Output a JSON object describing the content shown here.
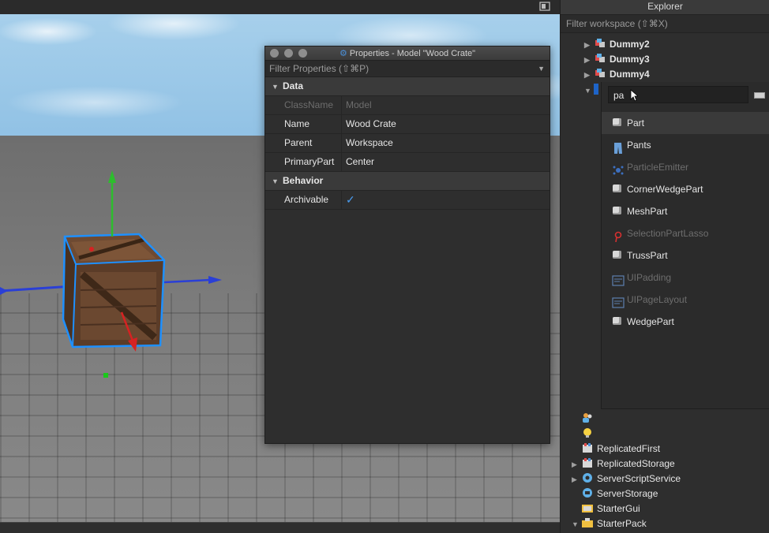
{
  "viewport": {
    "corner_icon": "screen-icon"
  },
  "properties": {
    "title": "Properties - Model \"Wood Crate\"",
    "filter_placeholder": "Filter Properties (⇧⌘P)",
    "sections": [
      {
        "name": "Data",
        "rows": [
          {
            "key": "ClassName",
            "value": "Model",
            "disabled": true
          },
          {
            "key": "Name",
            "value": "Wood Crate",
            "disabled": false
          },
          {
            "key": "Parent",
            "value": "Workspace",
            "disabled": false
          },
          {
            "key": "PrimaryPart",
            "value": "Center",
            "disabled": false
          }
        ]
      },
      {
        "name": "Behavior",
        "rows": [
          {
            "key": "Archivable",
            "value": "✓",
            "checkbox": true
          }
        ]
      }
    ]
  },
  "explorer": {
    "title": "Explorer",
    "filter_placeholder": "Filter workspace (⇧⌘X)",
    "top_items": [
      {
        "label": "Dummy2",
        "icon": "model-icon"
      },
      {
        "label": "Dummy3",
        "icon": "model-icon"
      },
      {
        "label": "Dummy4",
        "icon": "model-icon"
      }
    ],
    "bottom_items": [
      {
        "label": "ReplicatedFirst",
        "icon": "replicated-first-icon",
        "expandable": false
      },
      {
        "label": "ReplicatedStorage",
        "icon": "replicated-storage-icon",
        "expandable": true
      },
      {
        "label": "ServerScriptService",
        "icon": "server-script-service-icon",
        "expandable": true
      },
      {
        "label": "ServerStorage",
        "icon": "server-storage-icon",
        "expandable": false
      },
      {
        "label": "StarterGui",
        "icon": "starter-gui-icon",
        "expandable": false
      },
      {
        "label": "StarterPack",
        "icon": "starter-pack-icon",
        "expandable": true
      }
    ]
  },
  "insert_popup": {
    "search_value": "pa",
    "items": [
      {
        "label": "Part",
        "icon": "part-icon",
        "dim": false,
        "selected": true
      },
      {
        "label": "Pants",
        "icon": "pants-icon",
        "dim": false,
        "selected": false
      },
      {
        "label": "ParticleEmitter",
        "icon": "particle-emitter-icon",
        "dim": true,
        "selected": false
      },
      {
        "label": "CornerWedgePart",
        "icon": "part-icon",
        "dim": false,
        "selected": false
      },
      {
        "label": "MeshPart",
        "icon": "part-icon",
        "dim": false,
        "selected": false
      },
      {
        "label": "SelectionPartLasso",
        "icon": "lasso-icon",
        "dim": true,
        "selected": false
      },
      {
        "label": "TrussPart",
        "icon": "part-icon",
        "dim": false,
        "selected": false
      },
      {
        "label": "UIPadding",
        "icon": "ui-icon",
        "dim": true,
        "selected": false
      },
      {
        "label": "UIPageLayout",
        "icon": "ui-icon",
        "dim": true,
        "selected": false
      },
      {
        "label": "WedgePart",
        "icon": "part-icon",
        "dim": false,
        "selected": false
      }
    ]
  },
  "colors": {
    "accent": "#4a9cf0",
    "selection_box": "#1e90ff",
    "axis_x": "#2a3fd6",
    "axis_y": "#2dbd2d",
    "axis_z": "#d62222"
  }
}
